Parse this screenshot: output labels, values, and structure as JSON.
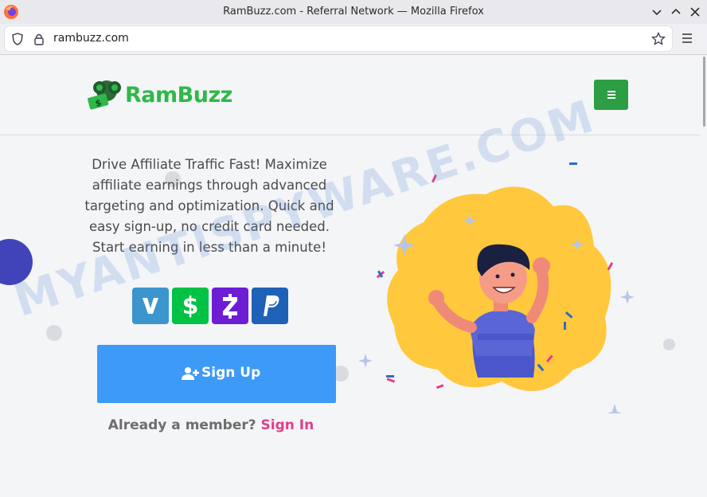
{
  "browser": {
    "window_title": "RamBuzz.com - Referral Network — Mozilla Firefox",
    "url": "rambuzz.com"
  },
  "site": {
    "logo_text": "RamBuzz",
    "tagline": "Drive Affiliate Traffic Fast! Maximize affiliate earnings through advanced targeting and optimization. Quick and easy sign-up, no credit card needed. Start earning in less than a minute!",
    "payment_icons": [
      "venmo-icon",
      "cashapp-icon",
      "zelle-icon",
      "paypal-icon"
    ],
    "signup_label": "Sign Up",
    "member_prompt": "Already a member?",
    "signin_label": "Sign In"
  },
  "watermark": "MYANTISPYWARE.COM",
  "colors": {
    "brand_green": "#2fb84a",
    "signup_blue": "#3d9af6",
    "signin_pink": "#e63c8a"
  }
}
